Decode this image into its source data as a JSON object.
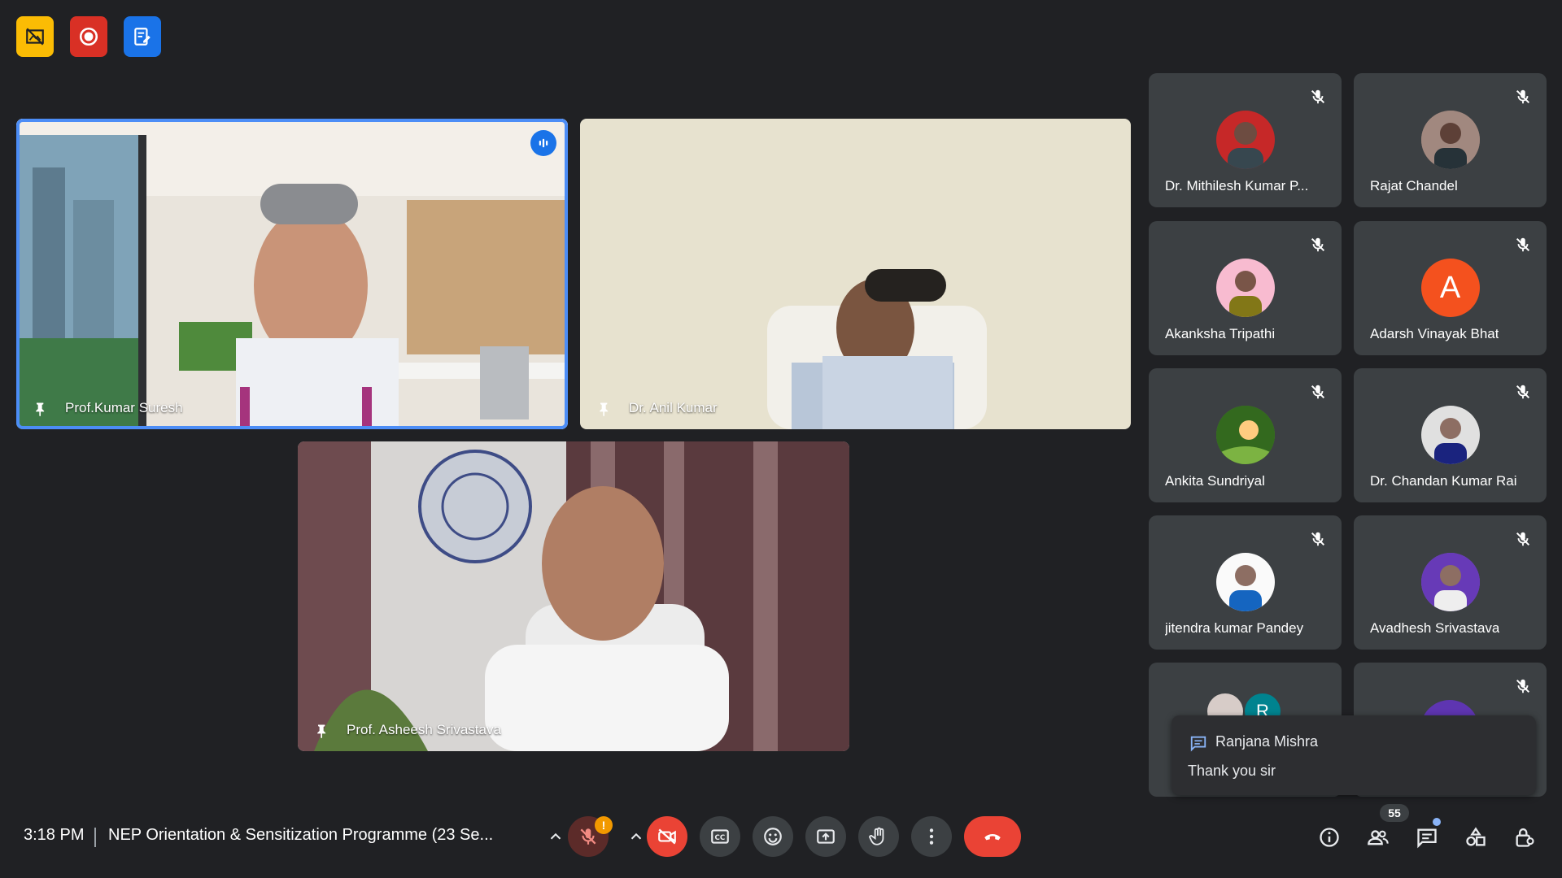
{
  "top_badges": [
    {
      "icon": "no-video-screen-icon",
      "color": "#fbbc04"
    },
    {
      "icon": "recording-icon",
      "color": "#d93025"
    },
    {
      "icon": "notes-icon",
      "color": "#1a73e8"
    }
  ],
  "tiles": {
    "speaker1": {
      "name": "Prof.Kumar Suresh"
    },
    "speaker2": {
      "name": "Dr. Anil Kumar"
    },
    "speaker3": {
      "name": "Prof. Asheesh Srivastava"
    }
  },
  "participants": [
    {
      "name": "Dr. Mithilesh Kumar P...",
      "avatar": "photo",
      "muted": true
    },
    {
      "name": "Rajat Chandel",
      "avatar": "photo",
      "muted": true
    },
    {
      "name": "Akanksha Tripathi",
      "avatar": "photo",
      "muted": true
    },
    {
      "name": "Adarsh Vinayak Bhat",
      "avatar": "letter",
      "letter": "A",
      "color": "#f4511e",
      "muted": true
    },
    {
      "name": "Ankita Sundriyal",
      "avatar": "photo",
      "muted": true
    },
    {
      "name": "Dr. Chandan Kumar Rai",
      "avatar": "photo",
      "muted": true
    },
    {
      "name": "jitendra kumar Pandey",
      "avatar": "photo",
      "muted": true
    },
    {
      "name": "Avadhesh Srivastava",
      "avatar": "photo",
      "muted": true
    }
  ],
  "partial_tiles": [
    {
      "letter": "R",
      "color": "#00838f"
    },
    {
      "color": "#5e35b1",
      "muted": true
    }
  ],
  "chat_toast": {
    "sender": "Ranjana Mishra",
    "message": "Thank you sir"
  },
  "bottom_bar": {
    "time": "3:18 PM",
    "meeting_title": "NEP Orientation & Sensitization Programme (23 Se...",
    "people_count": "55",
    "mic_alert": "!"
  },
  "colors": {
    "background": "#202124",
    "tile": "#3c4043",
    "end_call": "#ea4335",
    "active_border": "#4c8df6"
  }
}
